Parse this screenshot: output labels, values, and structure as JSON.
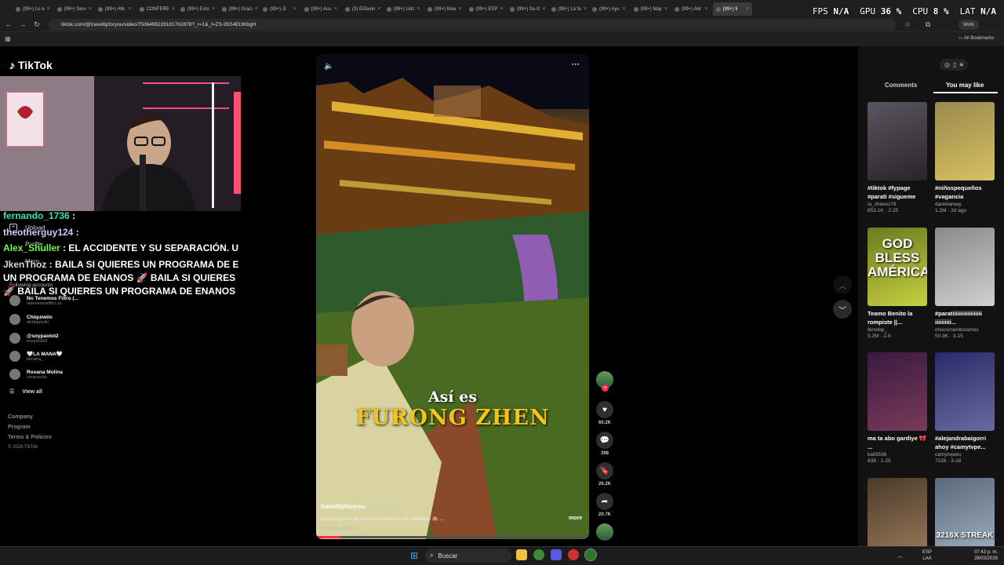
{
  "browser": {
    "tabs": [
      {
        "label": "(99+) Lo a"
      },
      {
        "label": "(99+) Serv"
      },
      {
        "label": "(99+) #tik"
      },
      {
        "label": "CONFERE"
      },
      {
        "label": "(99+) Estu"
      },
      {
        "label": "(99+) Graci"
      },
      {
        "label": "(99+) Ji"
      },
      {
        "label": "(99+) Acu"
      },
      {
        "label": "(3) ElZeein"
      },
      {
        "label": "(99+) Lidc"
      },
      {
        "label": "(99+) Bow"
      },
      {
        "label": "(99+) ESP"
      },
      {
        "label": "(99+) Sa G"
      },
      {
        "label": "(99+) La fa"
      },
      {
        "label": "(99+) Ayu"
      },
      {
        "label": "(99+) May"
      },
      {
        "label": "(99+) Abr"
      },
      {
        "label": "(99+) ti"
      }
    ],
    "url": "tiktok.com/@traveltipforyou/video/7506498228181762878?_r=1&_t=ZS-95S4EI3KbgH",
    "profile_label": "Work",
    "bookmarks_label": "All Bookmarks"
  },
  "hud": {
    "fps_label": "FPS",
    "fps_value": "N/A",
    "gpu_label": "GPU",
    "gpu_value": "36 %",
    "cpu_label": "CPU",
    "cpu_value": "8 %",
    "lat_label": "LAT",
    "lat_value": "N/A"
  },
  "tiktok": {
    "logo": "TikTok",
    "upload": "Upload",
    "profile": "Profile",
    "more": "More",
    "following_accounts": "Following accounts",
    "accounts": [
      {
        "name": "No Tenemos Filtro (...",
        "handle": "notenemosfiltro.zs"
      },
      {
        "name": "Chiquiwilo",
        "handle": "elchiquiwilo"
      },
      {
        "name": "@soypaolot2",
        "handle": "soypaolot2"
      },
      {
        "name": "🤍LA MANA🤍",
        "handle": "lamana_"
      },
      {
        "name": "Roxana Molina",
        "handle": "roxanacha"
      }
    ],
    "view_all": "View all",
    "footer": [
      "Company",
      "Program",
      "Terms & Policies"
    ],
    "copyright": "© 2026 TikTok"
  },
  "chat": [
    {
      "user": "fernando_1736",
      "sep": " :",
      "msg": "",
      "color": "#35e0b8"
    },
    {
      "user": "theotherguy124",
      "sep": " :",
      "msg": "",
      "color": "#c9c9ff"
    },
    {
      "user": "Alex_Shuller",
      "sep": " : ",
      "msg": "EL ACCIDENTE Y SU SEPARACIÓN. UN CUMU",
      "color": "#6bff3a"
    },
    {
      "user": "JkenThoz",
      "sep": " : ",
      "msg": "BAILA SI QUIERES UN PROGRAMA DE ENANOS",
      "color": "#d8d8d8"
    },
    {
      "user": "",
      "sep": "",
      "msg": "UN PROGRAMA DE ENANOS  🚀  BAILA SI QUIERES UN PRO",
      "color": "#fff"
    },
    {
      "user": "",
      "sep": "",
      "msg": "🚀  BAILA SI QUIERES UN PROGRAMA DE ENANOS  🚀  BAI",
      "color": "#fff"
    }
  ],
  "video": {
    "caption_line1": "Así es",
    "caption_line2": "FURONG ZHEN",
    "author": "traveltipforyou",
    "date": " · 2025-5-21",
    "description": "Estos lugares de China nos dejaron sin palabras 🙈 ...",
    "more": "more",
    "see_translation": "See translation",
    "progress": 0.09
  },
  "actions": {
    "likes": "60.2K",
    "comments": "398",
    "saves": "26.2K",
    "shares": "20.7K"
  },
  "panel": {
    "tab_comments": "Comments",
    "tab_you_may_like": "You may like",
    "cards": [
      {
        "title": "#tiktok #fypage #parati #sigueme",
        "author": "la_chavez76",
        "stats": "853.1K · 2-25",
        "colors": [
          "#5a5560",
          "#2a2428"
        ]
      },
      {
        "title": "#niñospequeños #vagancia",
        "author": "danielareey",
        "stats": "1.2M · 2d ago",
        "colors": [
          "#9a8a50",
          "#d8c060"
        ]
      },
      {
        "title": "Teamo Benito la rompiste ||...",
        "author": "ferxxbp_",
        "stats": "5.2M · 2-9",
        "colors": [
          "#6a7a20",
          "#c8d040"
        ],
        "overlay": "GOD BLESS AMÉRICA"
      },
      {
        "title": "#paratiiiiiiiiiiiiiiiiii iiiiiiiiii...",
        "author": "chocorramitoramos",
        "stats": "50.3K · 3-15",
        "colors": [
          "#8a8a8a",
          "#d0d0d0"
        ]
      },
      {
        "title": "ma ta abo gardiye 🎀 ...",
        "author": "kali9536",
        "stats": "838 · 1-25",
        "colors": [
          "#3a1a40",
          "#7a3a5a"
        ]
      },
      {
        "title": "#alejandrabaigorri ahoy #camytvpe...",
        "author": "camytvperu",
        "stats": "7226 · 3-18",
        "colors": [
          "#2a2a6a",
          "#6a6aa0"
        ]
      },
      {
        "title": "",
        "author": "",
        "stats": "",
        "colors": [
          "#4a3a2a",
          "#9a7a5a"
        ]
      },
      {
        "title": "",
        "author": "",
        "stats": "",
        "colors": [
          "#5a6a7a",
          "#a0b0c0"
        ],
        "overlay": "3216X STREAK"
      }
    ]
  },
  "taskbar": {
    "search": "Buscar",
    "lang1": "ESP",
    "lang2": "LAA",
    "time": "07:43 p. m.",
    "date": "28/03/2026"
  }
}
